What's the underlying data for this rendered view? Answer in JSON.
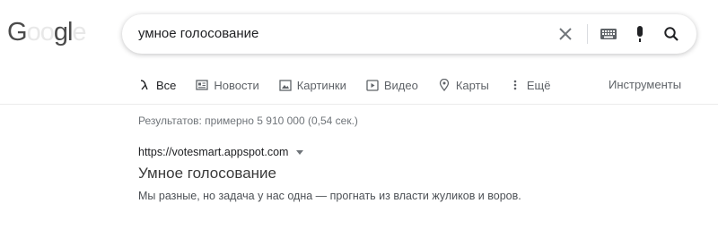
{
  "logo": {
    "text": "Google"
  },
  "search": {
    "query": "умное голосование"
  },
  "tabs": [
    {
      "label": "Все",
      "icon": "search-icon",
      "active": true
    },
    {
      "label": "Новости",
      "icon": "news-icon"
    },
    {
      "label": "Картинки",
      "icon": "image-icon"
    },
    {
      "label": "Видео",
      "icon": "video-icon"
    },
    {
      "label": "Карты",
      "icon": "map-pin-icon"
    },
    {
      "label": "Ещё",
      "icon": "more-vert-icon"
    }
  ],
  "tools_label": "Инструменты",
  "stats": "Результатов: примерно 5 910 000 (0,54 сек.)",
  "result": {
    "url": "https://votesmart.appspot.com",
    "title": "Умное голосование",
    "snippet": "Мы разные, но задача у нас одна — прогнать из власти жуликов и воров."
  },
  "colors": {
    "tab_active": "#202124",
    "muted": "#5f6368",
    "divider": "#ebebeb"
  }
}
